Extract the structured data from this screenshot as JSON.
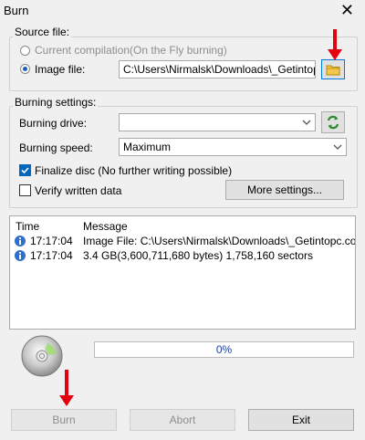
{
  "window": {
    "title": "Burn",
    "close_glyph": "✕"
  },
  "source": {
    "legend": "Source file:",
    "option_compilation": "Current compilation(On the Fly burning)",
    "option_image": "Image file:",
    "image_path": "C:\\Users\\Nirmalsk\\Downloads\\_Getintopc.com_",
    "browse_icon": "folder-icon"
  },
  "settings": {
    "legend": "Burning settings:",
    "drive_label": "Burning drive:",
    "drive_value": "",
    "refresh_icon": "refresh-icon",
    "speed_label": "Burning speed:",
    "speed_value": "Maximum",
    "finalize_label": "Finalize disc (No further writing possible)",
    "finalize_checked": true,
    "verify_label": "Verify written data",
    "verify_checked": false,
    "more_button": "More settings..."
  },
  "log": {
    "col_time": "Time",
    "col_message": "Message",
    "rows": [
      {
        "time": "17:17:04",
        "message": "Image File:  C:\\Users\\Nirmalsk\\Downloads\\_Getintopc.co..."
      },
      {
        "time": "17:17:04",
        "message": "3.4 GB(3,600,711,680 bytes)  1,758,160 sectors"
      }
    ]
  },
  "progress": {
    "value_percent": 0,
    "label": "0%"
  },
  "buttons": {
    "burn": "Burn",
    "abort": "Abort",
    "exit": "Exit"
  },
  "colors": {
    "accent": "#0078d7",
    "arrow": "#e3000f",
    "check": "#0067c0"
  }
}
